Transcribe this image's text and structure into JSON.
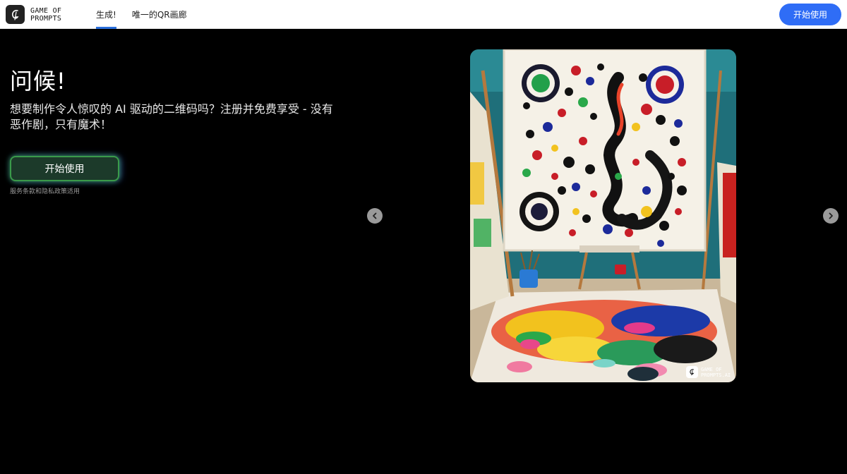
{
  "header": {
    "logo_text": "GAME OF PROMPTS",
    "logo_icon": "g-logo-icon",
    "tabs": [
      {
        "label": "生成!",
        "active": true
      },
      {
        "label": "唯一的QR画廊",
        "active": false
      }
    ],
    "cta_label": "开始使用"
  },
  "hero": {
    "title": "问候!",
    "subtitle": "想要制作令人惊叹的 AI 驱动的二维码吗？注册并免费享受 - 没有恶作剧，只有魔术！",
    "cta_label": "开始使用",
    "terms": "服务条款和隐私政策适用"
  },
  "carousel": {
    "prev_icon": "chevron-left-icon",
    "next_icon": "chevron-right-icon",
    "watermark_text": "GAME OF PROMPTS.AI"
  },
  "colors": {
    "accent": "#2f6df6",
    "background": "#000000",
    "cta_glow_green": "#3a9a4a",
    "cta_glow_blue": "#3c5ae6"
  }
}
